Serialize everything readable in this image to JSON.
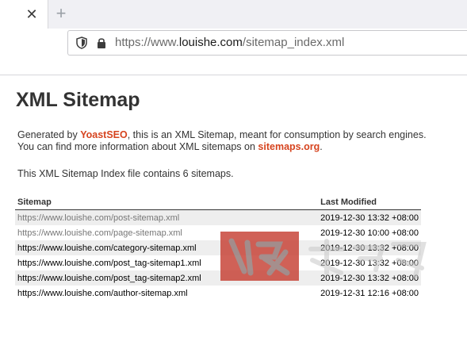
{
  "browser": {
    "tab_close_glyph": "✕",
    "new_tab_glyph": "+",
    "url_prefix": "https://www.",
    "url_domain": "louishe.com",
    "url_path": "/sitemap_index.xml",
    "icons": [
      "shield-icon",
      "lock-icon"
    ]
  },
  "page": {
    "title": "XML Sitemap",
    "desc_part1": "Generated by ",
    "desc_link1": "YoastSEO",
    "desc_part2": ", this is an XML Sitemap, meant for consumption by search engines.",
    "desc_part3": "You can find more information about XML sitemaps on ",
    "desc_link2": "sitemaps.org",
    "desc_part4": ".",
    "count_text": "This XML Sitemap Index file contains 6 sitemaps.",
    "link_color": "#d6441f"
  },
  "table": {
    "headers": [
      "Sitemap",
      "Last Modified"
    ],
    "rows": [
      {
        "url": "https://www.louishe.com/post-sitemap.xml",
        "modified": "2019-12-30 13:32 +08:00"
      },
      {
        "url": "https://www.louishe.com/page-sitemap.xml",
        "modified": "2019-12-30 10:00 +08:00"
      },
      {
        "url": "https://www.louishe.com/category-sitemap.xml",
        "modified": "2019-12-30 13:32 +08:00"
      },
      {
        "url": "https://www.louishe.com/post_tag-sitemap1.xml",
        "modified": "2019-12-30 13:32 +08:00"
      },
      {
        "url": "https://www.louishe.com/post_tag-sitemap2.xml",
        "modified": "2019-12-30 13:32 +08:00"
      },
      {
        "url": "https://www.louishe.com/author-sitemap.xml",
        "modified": "2019-12-31 12:16 +08:00"
      }
    ]
  },
  "watermark": {
    "color": "#c8463a"
  }
}
